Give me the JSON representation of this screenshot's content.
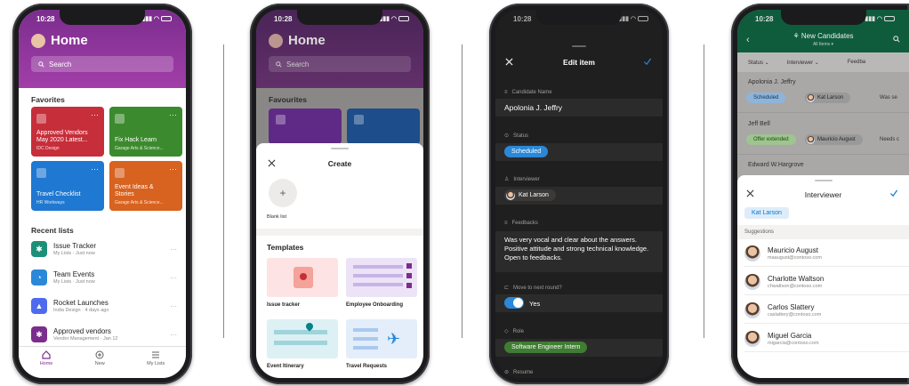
{
  "colors": {
    "lists_purple": "#7b2d8e",
    "green_header": "#0f6e47",
    "accent_blue": "#0078d4"
  },
  "phone1": {
    "time": "10:28",
    "title": "Home",
    "search_placeholder": "Search",
    "favorites_title": "Favorites",
    "favorites": [
      {
        "title": "Approved Vendors May 2020 Latest...",
        "subtitle": "IDC Design",
        "color": "#c62e3a",
        "icon": "clipboard-icon"
      },
      {
        "title": "Fix Hack Learn",
        "subtitle": "Garage Arts & Science...",
        "color": "#3c8a2e",
        "icon": "plane-icon"
      },
      {
        "title": "Travel Checklist",
        "subtitle": "HR Workways",
        "color": "#1f78d1",
        "icon": "cube-icon"
      },
      {
        "title": "Event Ideas & Stories",
        "subtitle": "Garage Arts & Science...",
        "color": "#d8621f",
        "icon": "calendar-icon"
      }
    ],
    "recent_title": "Recent lists",
    "recent": [
      {
        "name": "Issue Tracker",
        "sub": "My Lists · Just now",
        "color": "#1d8f79",
        "icon": "bug-icon"
      },
      {
        "name": "Team Events",
        "sub": "My Lists · Just now",
        "color": "#2b88d8",
        "icon": "headphones-icon"
      },
      {
        "name": "Rocket Launches",
        "sub": "India Design · 4 days ago",
        "color": "#4f6bed",
        "icon": "rocket-icon"
      },
      {
        "name": "Approved vendors",
        "sub": "Vendor Management · Jan 12",
        "color": "#7b2d8e",
        "icon": "bug-icon"
      }
    ],
    "tabs": [
      {
        "label": "Home",
        "icon": "home-icon"
      },
      {
        "label": "New",
        "icon": "plus-circle-icon"
      },
      {
        "label": "My Lists",
        "icon": "lists-icon"
      }
    ]
  },
  "phone2": {
    "time": "10:28",
    "title": "Home",
    "search_placeholder": "Search",
    "favorites_title": "Favourites",
    "sheet_title": "Create",
    "blank_label": "Blank list",
    "templates_title": "Templates",
    "templates": [
      {
        "label": "Issue tracker",
        "color": "#fde3e3"
      },
      {
        "label": "Employee Onboarding",
        "color": "#ece3f7"
      },
      {
        "label": "Event Itinerary",
        "color": "#ddf0f3"
      },
      {
        "label": "Travel Requests",
        "color": "#e3eefa"
      }
    ]
  },
  "phone3": {
    "time": "10:28",
    "title": "Edit item",
    "fields": {
      "candidate_label": "Candidate Name",
      "candidate_value": "Apolonia J. Jeffry",
      "status_label": "Status",
      "status_value": "Scheduled",
      "interviewer_label": "Interviewer",
      "interviewer_value": "Kat Larson",
      "feedbacks_label": "Feedbacks",
      "feedbacks_value": "Was very vocal and clear about the answers. Positive attitude and strong technical knowledge. Open to feedbacks.",
      "move_label": "Move to next round?",
      "move_value": "Yes",
      "role_label": "Role",
      "role_value": "Software Engineer Intern",
      "resume_label": "Resume"
    }
  },
  "phone4": {
    "time": "10:28",
    "title": "New Candidates",
    "subtitle": "All Items ▾",
    "columns": [
      "Status ⌄",
      "Interviewer ⌄",
      "Feedba"
    ],
    "rows": [
      {
        "name": "Apolonia J. Jeffry",
        "status": "Scheduled",
        "interviewer": "Kat Larson",
        "extra": "Was se"
      },
      {
        "name": "Jeff Bell",
        "status": "Offer extended",
        "interviewer": "Mauricio August",
        "extra": "Needs c"
      },
      {
        "name": "Edward W.Hargrove"
      }
    ],
    "sheet_title": "Interviewer",
    "selected_chip": "Kat Larson",
    "suggestions_label": "Suggestions",
    "suggestions": [
      {
        "name": "Mauricio August",
        "email": "maaugust@contoso.com"
      },
      {
        "name": "Charlotte Waltson",
        "email": "chwaltson@contoso.com"
      },
      {
        "name": "Carlos Slattery",
        "email": "caslattery@contoso.com"
      },
      {
        "name": "Miguel Garcia",
        "email": "migarcia@contoso.com"
      }
    ]
  }
}
